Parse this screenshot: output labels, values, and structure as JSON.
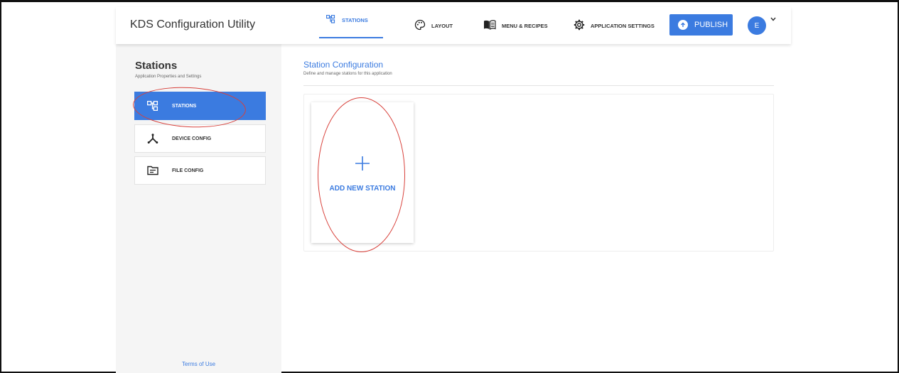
{
  "app": {
    "title": "KDS Configuration Utility"
  },
  "nav": {
    "stations": "STATIONS",
    "layout": "LAYOUT",
    "menu_recipes": "MENU & RECIPES",
    "application_settings": "APPLICATION SETTINGS",
    "publish": "PUBLISH",
    "avatar_initial": "E"
  },
  "sidebar": {
    "title": "Stations",
    "subtitle": "Application Properties and Settings",
    "items": [
      {
        "label": "STATIONS",
        "icon": "stations-icon",
        "active": true
      },
      {
        "label": "DEVICE CONFIG",
        "icon": "device-config-icon",
        "active": false
      },
      {
        "label": "FILE CONFIG",
        "icon": "file-config-icon",
        "active": false
      }
    ],
    "terms": "Terms of Use"
  },
  "main": {
    "title": "Station Configuration",
    "subtitle": "Define and manage stations for this application",
    "add_card": {
      "icon": "plus-icon",
      "label": "ADD NEW STATION"
    }
  },
  "colors": {
    "accent": "#3b7be0",
    "annotation": "#d8403a",
    "sidebar_bg": "#f5f5f5"
  }
}
